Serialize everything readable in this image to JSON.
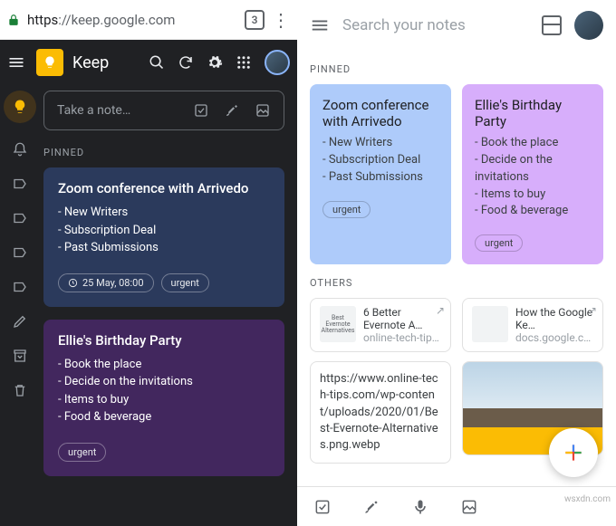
{
  "browser": {
    "url_scheme": "https",
    "url_rest": "://keep.google.com",
    "tab_count": "3"
  },
  "app": {
    "name": "Keep"
  },
  "take_note": {
    "placeholder": "Take a note…"
  },
  "sections": {
    "pinned": "PINNED",
    "others": "OTHERS"
  },
  "search": {
    "placeholder": "Search your notes"
  },
  "notes": {
    "pinned": [
      {
        "title": "Zoom conference with Arrivedo",
        "items": [
          "New Writers",
          "Subscription Deal",
          "Past Submissions"
        ],
        "reminder": "25 May, 08:00",
        "tag": "urgent"
      },
      {
        "title": "Ellie's Birthday Party",
        "items": [
          "Book the place",
          "Decide on the invitations",
          "Items to buy",
          "Food & beverage"
        ],
        "tag": "urgent"
      }
    ]
  },
  "rightNotes": {
    "pinned": [
      {
        "title": "Zoom conference with Arrivedo",
        "items": [
          "New Writers",
          "Subscription Deal",
          "Past Submissions"
        ],
        "tag": "urgent"
      },
      {
        "title": "Ellie's Birthday Party",
        "items": [
          "Book the place",
          "Decide on the invitations",
          "Items to buy",
          "Food & beverage"
        ],
        "tag": "urgent"
      }
    ],
    "others": [
      {
        "thumb": "Best Evernote Alternatives",
        "title": "6 Better Evernote A…",
        "source": "online-tech-tip…"
      },
      {
        "thumb": "",
        "title": "How the Google Ke…",
        "source": "docs.google.c…"
      }
    ],
    "urlnote": "https://www.online-tech-tips.com/wp-content/uploads/2020/01/Best-Evernote-Alternatives.png.webp"
  },
  "watermark": "wsxdn.com"
}
